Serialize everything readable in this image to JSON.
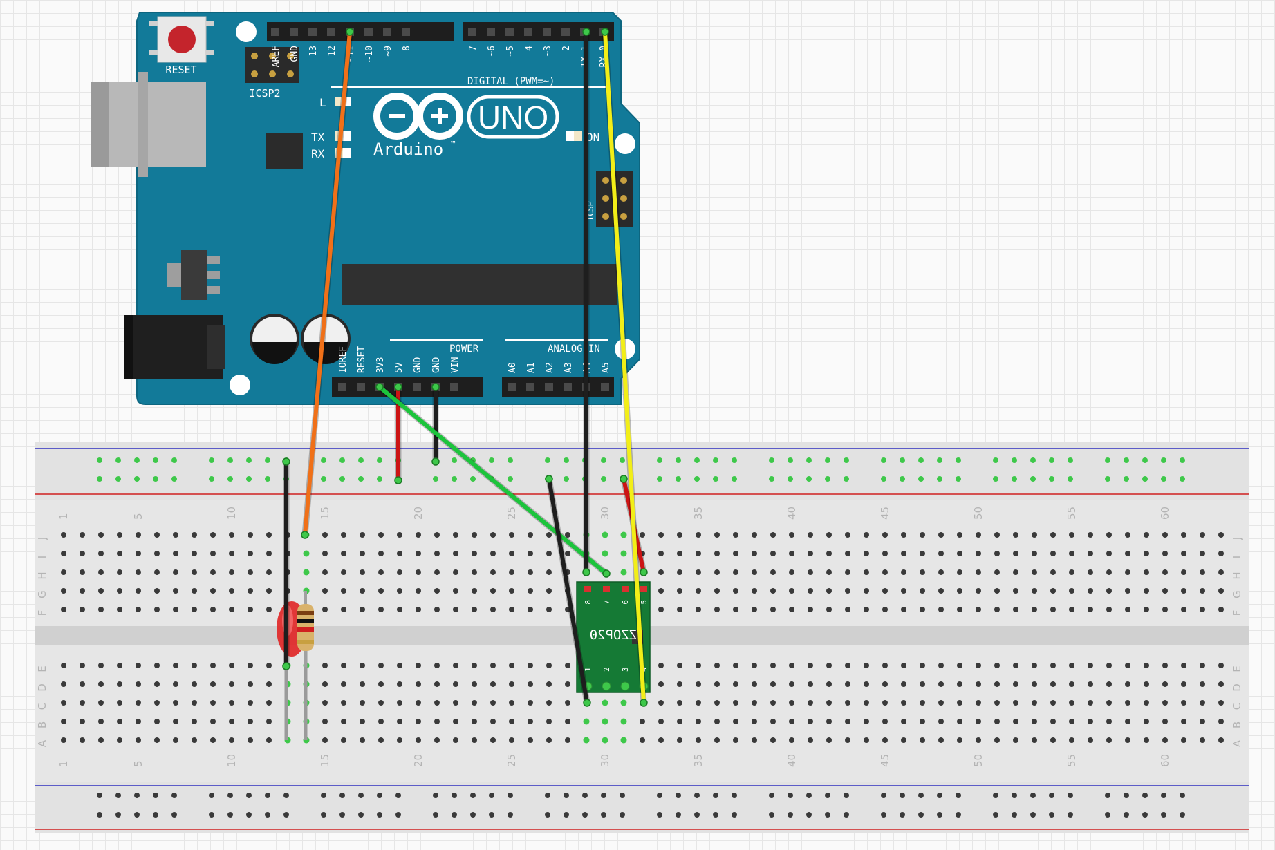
{
  "board": {
    "reset_label": "RESET",
    "icsp2_label": "ICSP2",
    "icsp_label": "ICSP",
    "brand_label": "Arduino",
    "model_label": "UNO",
    "tm_mark": "™",
    "digital_label": "DIGITAL (PWM=~)",
    "power_label": "POWER",
    "analog_label": "ANALOG IN",
    "led_l_label": "L",
    "tx_label": "TX",
    "rx_label": "RX",
    "on_label": "ON",
    "digital_pins_left": [
      "AREF",
      "GND",
      "13",
      "12",
      "~11",
      "~10",
      "~9",
      "8"
    ],
    "digital_pins_right": [
      "7",
      "~6",
      "~5",
      "4",
      "~3",
      "2",
      "TX 1",
      "RX 0"
    ],
    "power_pins": [
      "IOREF",
      "RESET",
      "3V3",
      "5V",
      "GND",
      "GND",
      "VIN"
    ],
    "analog_pins": [
      "A0",
      "A1",
      "A2",
      "A3",
      "A4",
      "A5"
    ]
  },
  "breadboard": {
    "column_numbers": [
      "1",
      "5",
      "10",
      "15",
      "20",
      "25",
      "30",
      "35",
      "40",
      "45",
      "50",
      "55",
      "60"
    ],
    "rows_top": [
      "J",
      "I",
      "H",
      "G",
      "F"
    ],
    "rows_bottom": [
      "E",
      "D",
      "C",
      "B",
      "A"
    ]
  },
  "sensor_module": {
    "chip_label": "ZZOP20",
    "pins_top": [
      "8",
      "7",
      "6",
      "5"
    ],
    "pins_bottom": [
      "1",
      "2",
      "3",
      "4"
    ]
  },
  "wires": [
    {
      "name": "orange-wire",
      "color": "#f07018"
    },
    {
      "name": "yellow-wire",
      "color": "#f2ee18"
    },
    {
      "name": "green-wire",
      "color": "#1cc43c"
    },
    {
      "name": "red-wire",
      "color": "#cc1414"
    },
    {
      "name": "black-wire",
      "color": "#1e1e1e"
    }
  ],
  "colors": {
    "board": "#127a99",
    "breadboard": "#e4e4e4",
    "module": "#157a35",
    "power_rail_positive": "#d02020",
    "power_rail_negative": "#3030c0",
    "led": "#e02424"
  }
}
